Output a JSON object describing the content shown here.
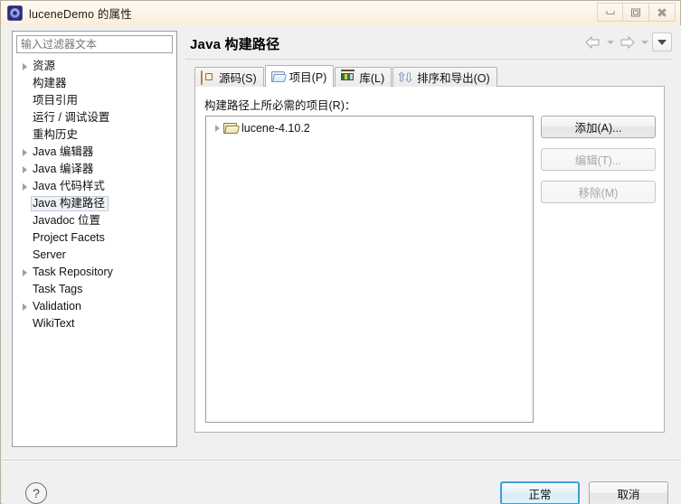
{
  "window": {
    "title": "luceneDemo 的属性",
    "icon": "eclipse-project-icon",
    "buttons": {
      "minimize": "minimize-icon",
      "maximize": "restore-icon",
      "close": "close-icon"
    }
  },
  "sidebar": {
    "filter": {
      "placeholder": "输入过滤器文本",
      "value": ""
    },
    "items": [
      {
        "label": "资源",
        "expandable": true,
        "selected": false
      },
      {
        "label": "构建器",
        "expandable": false,
        "selected": false
      },
      {
        "label": "项目引用",
        "expandable": false,
        "selected": false
      },
      {
        "label": "运行 / 调试设置",
        "expandable": false,
        "selected": false
      },
      {
        "label": "重构历史",
        "expandable": false,
        "selected": false
      },
      {
        "label": "Java 编辑器",
        "expandable": true,
        "selected": false
      },
      {
        "label": "Java 编译器",
        "expandable": true,
        "selected": false
      },
      {
        "label": "Java 代码样式",
        "expandable": true,
        "selected": false
      },
      {
        "label": "Java 构建路径",
        "expandable": false,
        "selected": true
      },
      {
        "label": "Javadoc 位置",
        "expandable": false,
        "selected": false
      },
      {
        "label": "Project Facets",
        "expandable": false,
        "selected": false
      },
      {
        "label": "Server",
        "expandable": false,
        "selected": false
      },
      {
        "label": "Task Repository",
        "expandable": true,
        "selected": false
      },
      {
        "label": "Task Tags",
        "expandable": false,
        "selected": false
      },
      {
        "label": "Validation",
        "expandable": true,
        "selected": false
      },
      {
        "label": "WikiText",
        "expandable": false,
        "selected": false
      }
    ]
  },
  "pane": {
    "title": "Java 构建路径",
    "nav": {
      "back": "back-arrow-icon",
      "back_menu": "chevron-down-icon",
      "forward": "forward-arrow-icon",
      "forward_menu": "chevron-down-icon",
      "menu": "view-menu-icon"
    },
    "tabs": [
      {
        "label": "源码(S)",
        "icon": "source-folder-icon",
        "active": false
      },
      {
        "label": "项目(P)",
        "icon": "project-folder-icon",
        "active": true
      },
      {
        "label": "库(L)",
        "icon": "library-books-icon",
        "active": false
      },
      {
        "label": "排序和导出(O)",
        "icon": "order-export-icon",
        "active": false
      }
    ],
    "content": {
      "label": "构建路径上所必需的项目(R)：",
      "list": [
        {
          "name": "lucene-4.10.2",
          "icon": "folder-icon",
          "expandable": true
        }
      ],
      "actions": [
        {
          "label": "添加(A)...",
          "enabled": true
        },
        {
          "label": "编辑(T)...",
          "enabled": false
        },
        {
          "label": "移除(M)",
          "enabled": false
        }
      ]
    }
  },
  "footer": {
    "help": "?",
    "ok": "正常",
    "cancel": "取消"
  },
  "colors": {
    "titlebar": "#fdf5e7",
    "dialog_bg": "#f0f0f0",
    "default_button_border": "#3c9fd4",
    "selection": "#eef2f7"
  }
}
